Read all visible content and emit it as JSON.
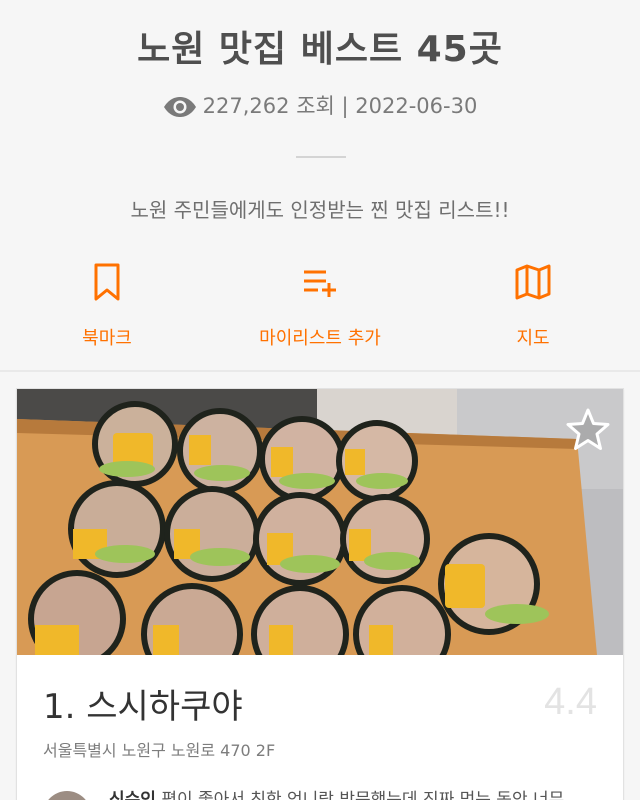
{
  "header": {
    "title": "노원 맛집 베스트 45곳",
    "views": "227,262 조회",
    "date_separator": " | ",
    "date": "2022-06-30",
    "description": "노원 주민들에게도 인정받는 찐 맛집 리스트!!"
  },
  "actions": [
    {
      "label": "북마크",
      "icon": "bookmark-icon"
    },
    {
      "label": "마이리스트 추가",
      "icon": "playlist-add-icon"
    },
    {
      "label": "지도",
      "icon": "map-icon"
    }
  ],
  "colors": {
    "accent": "#ff7100",
    "text": "#4f4f4f",
    "background": "#f6f6f6"
  },
  "restaurant": {
    "name": "1. 스시하쿠야",
    "rating": "4.4",
    "address": "서울특별시 노원구 노원로 470  2F",
    "review_author": "신수인",
    "review_text": " 평이 좋아서 친한 언니랑 방문했는데 진짜 먹는 동안 너무"
  }
}
